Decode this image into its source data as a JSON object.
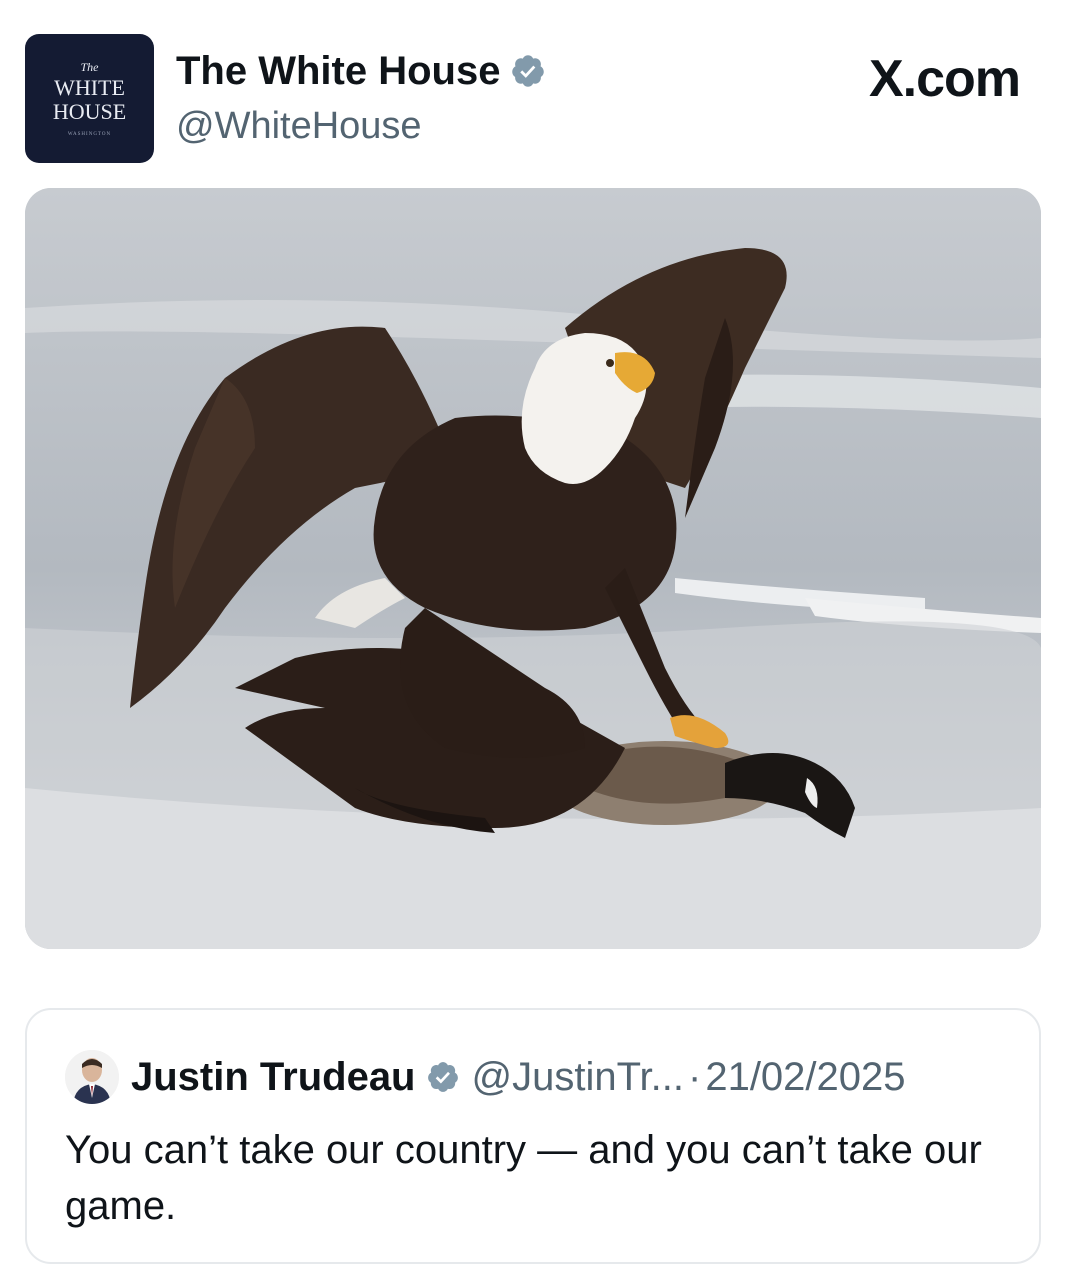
{
  "post": {
    "author": {
      "display_name": "The White House",
      "handle": "@WhiteHouse",
      "verified": true,
      "avatar_icon": "white-house-logo",
      "avatar_text": {
        "line0": "The",
        "line1": "WHITE",
        "line2": "HOUSE",
        "line3": "WASHINGTON"
      }
    },
    "site_label": "X.com",
    "media": {
      "kind": "photo",
      "description_icon": "eagle-on-goose-photo"
    }
  },
  "quoted_post": {
    "author": {
      "display_name": "Justin Trudeau",
      "handle": "@JustinTr...",
      "verified": true,
      "avatar_icon": "person-avatar"
    },
    "separator": "·",
    "date": "21/02/2025",
    "text": "You can’t take our country — and you can’t take our game."
  },
  "colors": {
    "verified_badge": "#829aab",
    "secondary_text": "#536471",
    "avatar_bg": "#141b33",
    "card_border": "#e6e9ec"
  }
}
